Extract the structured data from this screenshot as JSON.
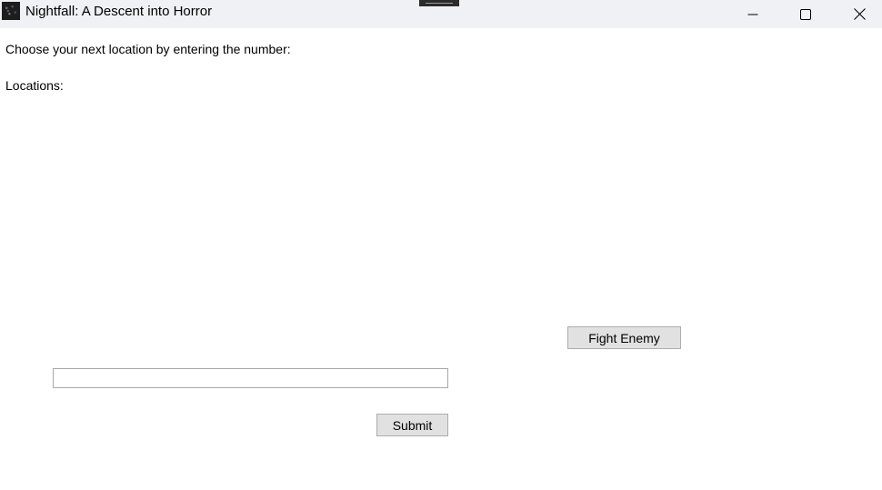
{
  "window": {
    "title": "Nightfall: A Descent into Horror",
    "icon": "app-icon"
  },
  "controls": {
    "minimize_icon": "minimize-icon",
    "maximize_icon": "maximize-icon",
    "close_icon": "close-icon"
  },
  "main": {
    "prompt": "Choose your next location by entering the number:",
    "locations_label": "Locations:",
    "locations": [],
    "fight_button": "Fight Enemy",
    "location_input": {
      "value": "",
      "placeholder": ""
    },
    "submit_button": "Submit"
  }
}
